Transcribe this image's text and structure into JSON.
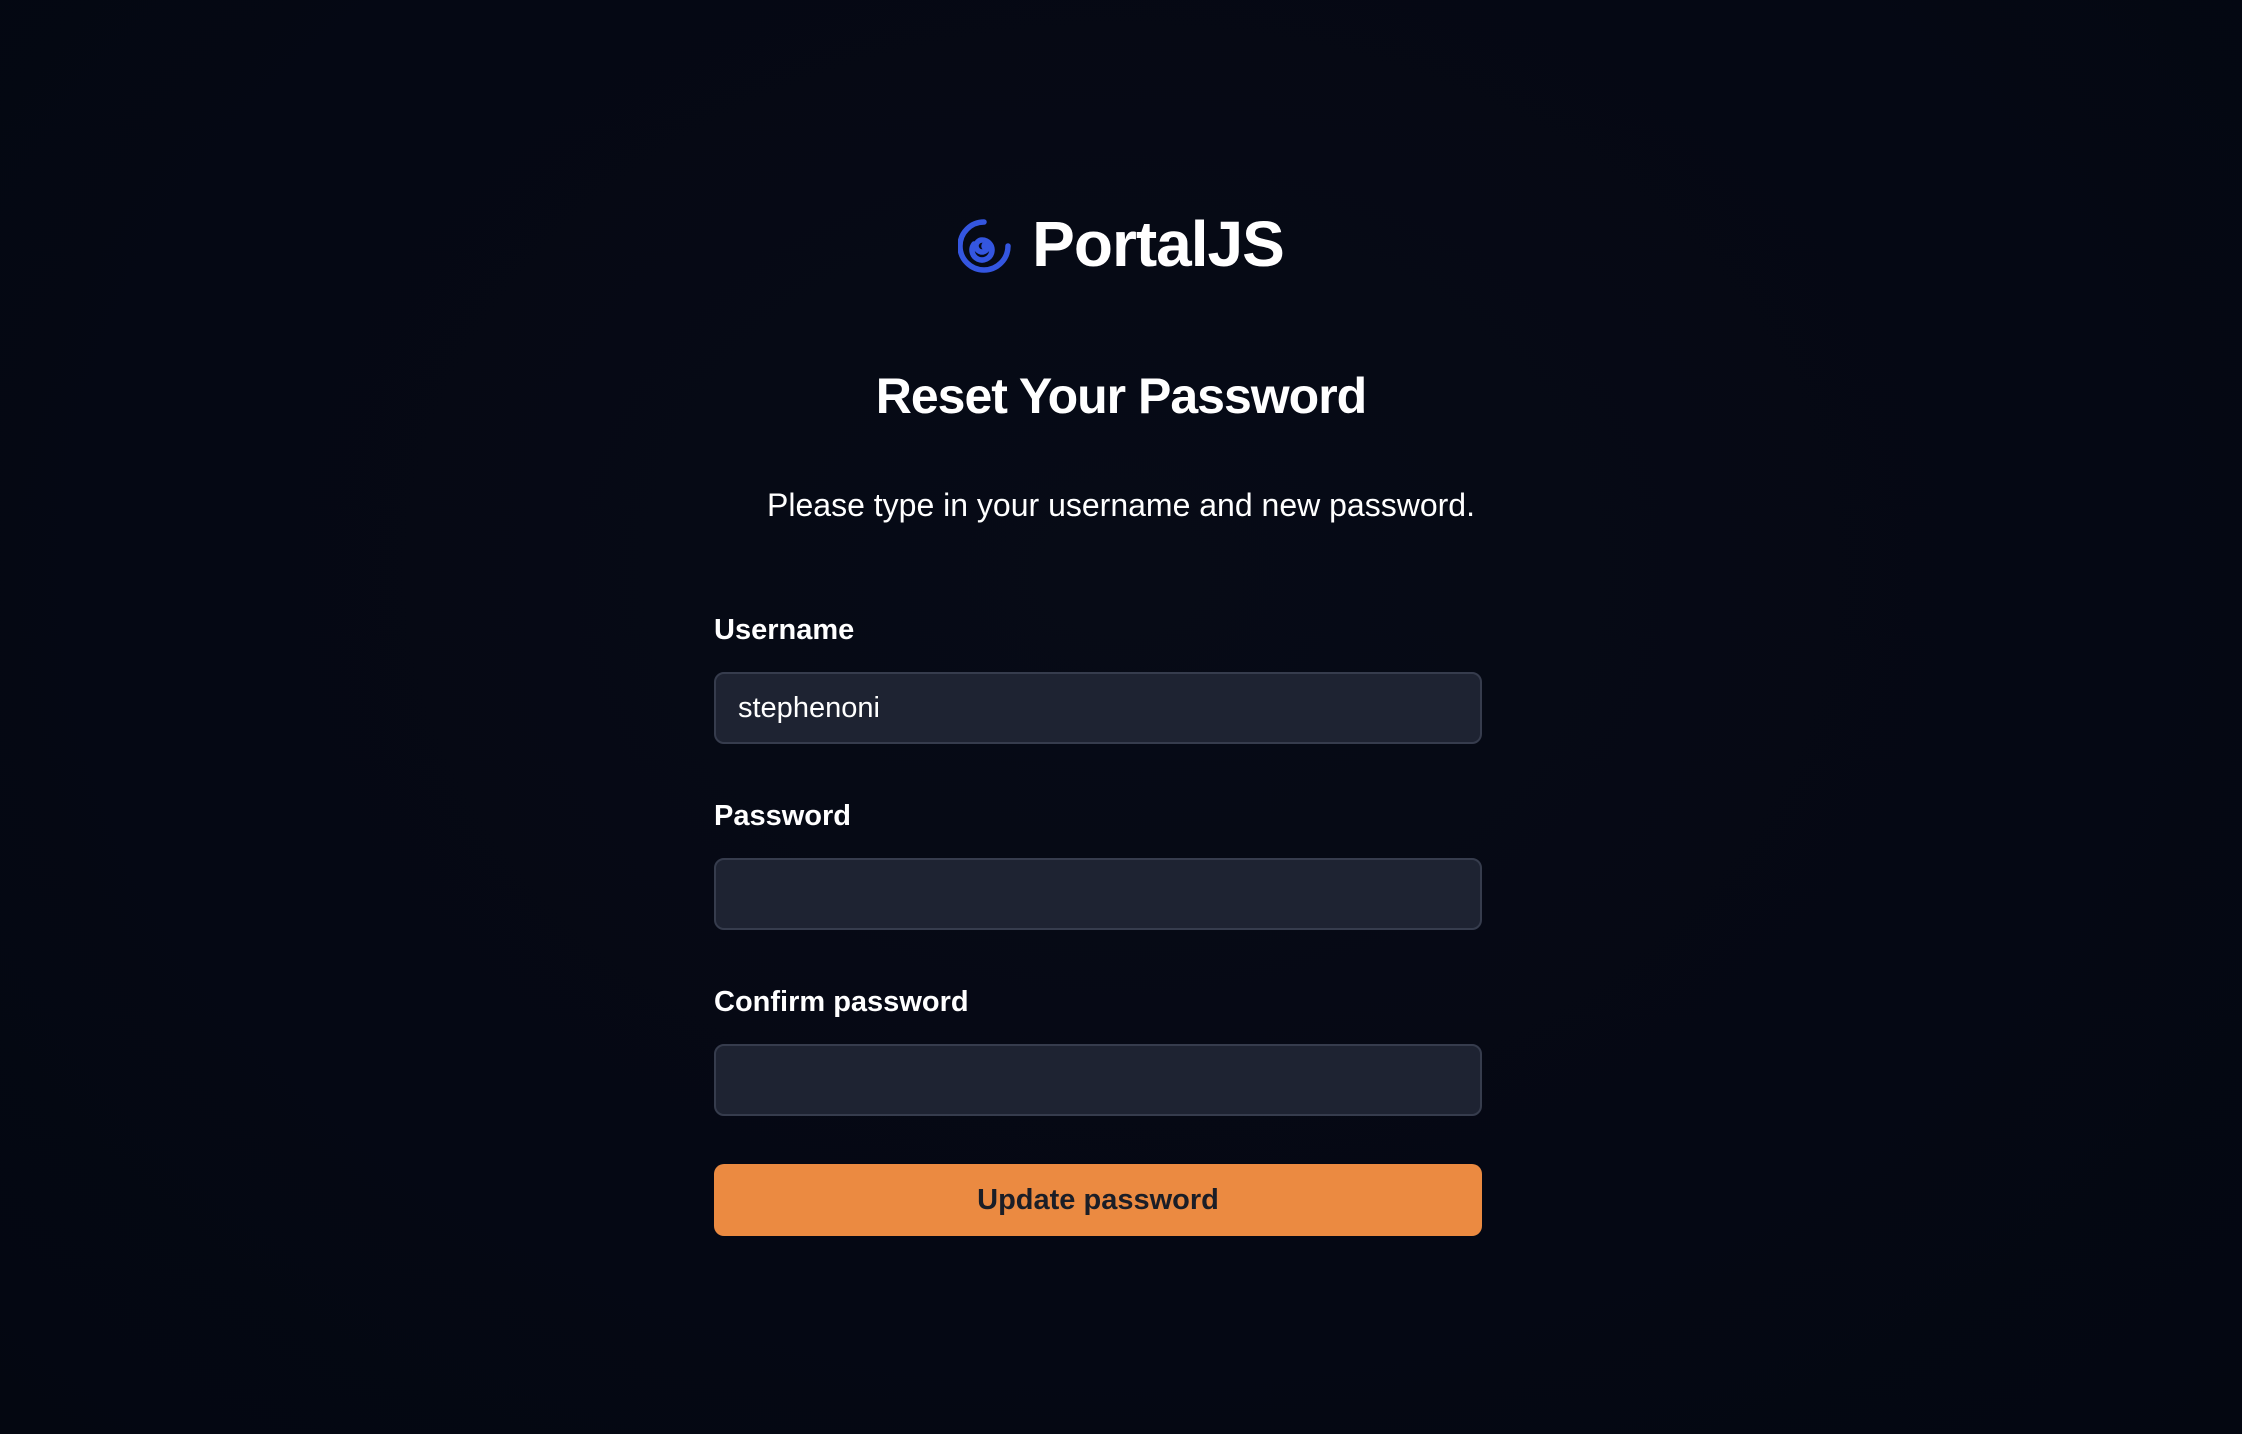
{
  "brand": {
    "name": "PortalJS",
    "logo_icon": "spiral-icon",
    "logo_color": "#3b5bdb"
  },
  "heading": {
    "title": "Reset Your Password",
    "subtitle": "Please type in your username and new password."
  },
  "form": {
    "username": {
      "label": "Username",
      "value": "stephenoni"
    },
    "password": {
      "label": "Password",
      "value": ""
    },
    "confirm_password": {
      "label": "Confirm password",
      "value": ""
    },
    "submit_label": "Update password"
  },
  "colors": {
    "background": "#060913",
    "input_background": "#1e2332",
    "input_border": "#363c4d",
    "accent": "#eb8a41",
    "text": "#ffffff"
  }
}
